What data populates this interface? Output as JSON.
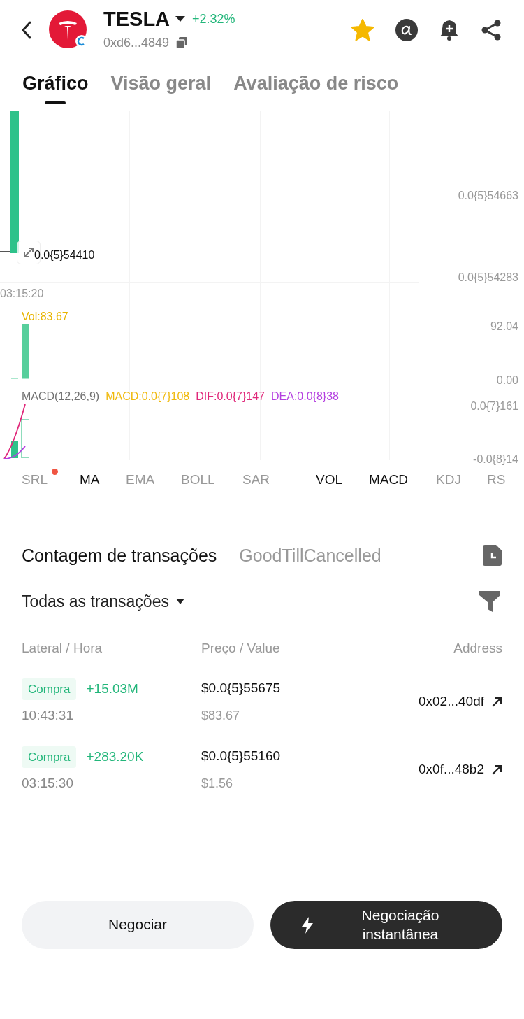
{
  "header": {
    "token": "TESLA",
    "change": "+2.32%",
    "address": "0xd6...4849",
    "favorite": true
  },
  "tabs": [
    {
      "label": "Gráfico",
      "selected": true
    },
    {
      "label": "Visão geral",
      "selected": false
    },
    {
      "label": "Avaliação de risco",
      "selected": false
    }
  ],
  "chart": {
    "price_axis": [
      "0.0{5}54663",
      "0.0{5}54283"
    ],
    "last_price": "0.0{5}54410",
    "time_label": "03:15:20",
    "volume": {
      "label": "Vol:83.67",
      "axis": [
        "92.04",
        "0.00"
      ]
    },
    "macd": {
      "legend": [
        {
          "text": "MACD(12,26,9)",
          "color": "#707070"
        },
        {
          "text": "MACD:0.0{7}108",
          "color": "#f0b90b"
        },
        {
          "text": "DIF:0.0{7}147",
          "color": "#e0287a"
        },
        {
          "text": "DEA:0.0{8}38",
          "color": "#b43ee0"
        }
      ],
      "axis": [
        "0.0{7}161",
        "-0.0{8}14"
      ]
    }
  },
  "indicators": [
    {
      "label": "SRL",
      "selected": false,
      "dot": true
    },
    {
      "label": "MA",
      "selected": true,
      "dot": false
    },
    {
      "label": "EMA",
      "selected": false,
      "dot": false
    },
    {
      "label": "BOLL",
      "selected": false,
      "dot": false
    },
    {
      "label": "SAR",
      "selected": false,
      "dot": false
    },
    {
      "label": "VOL",
      "selected": true,
      "dot": false
    },
    {
      "label": "MACD",
      "selected": true,
      "dot": false
    },
    {
      "label": "KDJ",
      "selected": false,
      "dot": false
    },
    {
      "label": "RS",
      "selected": false,
      "dot": false
    }
  ],
  "section_tabs": [
    {
      "label": "Contagem de transações",
      "selected": true
    },
    {
      "label": "GoodTillCancelled",
      "selected": false
    }
  ],
  "filter": {
    "label": "Todas as transações"
  },
  "table": {
    "columns": [
      "Lateral / Hora",
      "Preço / Value",
      "Address"
    ],
    "rows": [
      {
        "side": "Compra",
        "amount": "+15.03M",
        "time": "10:43:31",
        "price": "$0.0{5}55675",
        "value": "$83.67",
        "address": "0x02...40df"
      },
      {
        "side": "Compra",
        "amount": "+283.20K",
        "time": "03:15:30",
        "price": "$0.0{5}55160",
        "value": "$1.56",
        "address": "0x0f...48b2"
      }
    ]
  },
  "buttons": [
    {
      "label": "Negociar",
      "kind": "secondary"
    },
    {
      "label": "Negociação instantânea",
      "kind": "primary"
    }
  ]
}
